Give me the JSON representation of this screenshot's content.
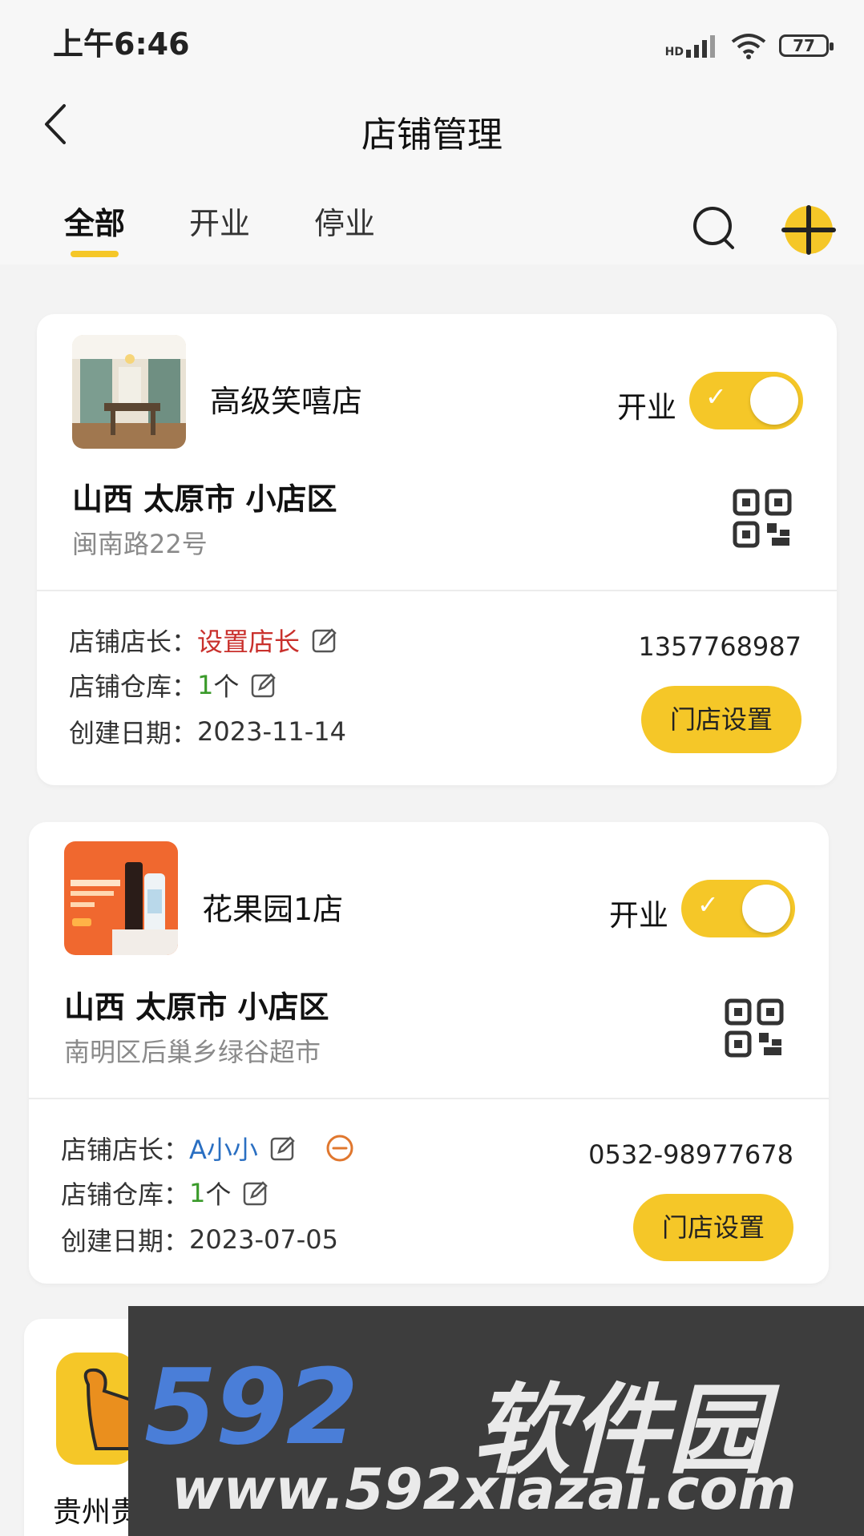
{
  "status_bar": {
    "time": "上午6:46",
    "network": "HD",
    "battery": "77"
  },
  "header": {
    "title": "店铺管理"
  },
  "tabs": [
    {
      "label": "全部"
    },
    {
      "label": "开业"
    },
    {
      "label": "停业"
    }
  ],
  "stores": [
    {
      "name": "高级笑嘻店",
      "status_label": "开业",
      "is_open": true,
      "region": "山西 太原市 小店区",
      "address": "闽南路22号",
      "manager_label": "店铺店长：",
      "manager_value": "设置店长",
      "warehouse_label": "店铺仓库：",
      "warehouse_count": "1",
      "warehouse_unit": "个",
      "created_label": "创建日期：",
      "created_date": "2023-11-14",
      "phone": "1357768987",
      "settings_label": "门店设置"
    },
    {
      "name": "花果园1店",
      "status_label": "开业",
      "is_open": true,
      "region": "山西 太原市 小店区",
      "address": "南明区后巢乡绿谷超市",
      "manager_label": "店铺店长：",
      "manager_value": "A小小",
      "warehouse_label": "店铺仓库：",
      "warehouse_count": "1",
      "warehouse_unit": "个",
      "created_label": "创建日期：",
      "created_date": "2023-07-05",
      "phone": "0532-98977678",
      "settings_label": "门店设置"
    },
    {
      "name": "贵州贵"
    }
  ],
  "watermark": {
    "logo": "592",
    "logo_cn": "软件园",
    "url": "www.592xiazai.com"
  },
  "colors": {
    "accent": "#f5c728",
    "manager_unset": "#c9302c",
    "manager_set": "#2a6fc2",
    "count": "#3a9a2a"
  }
}
